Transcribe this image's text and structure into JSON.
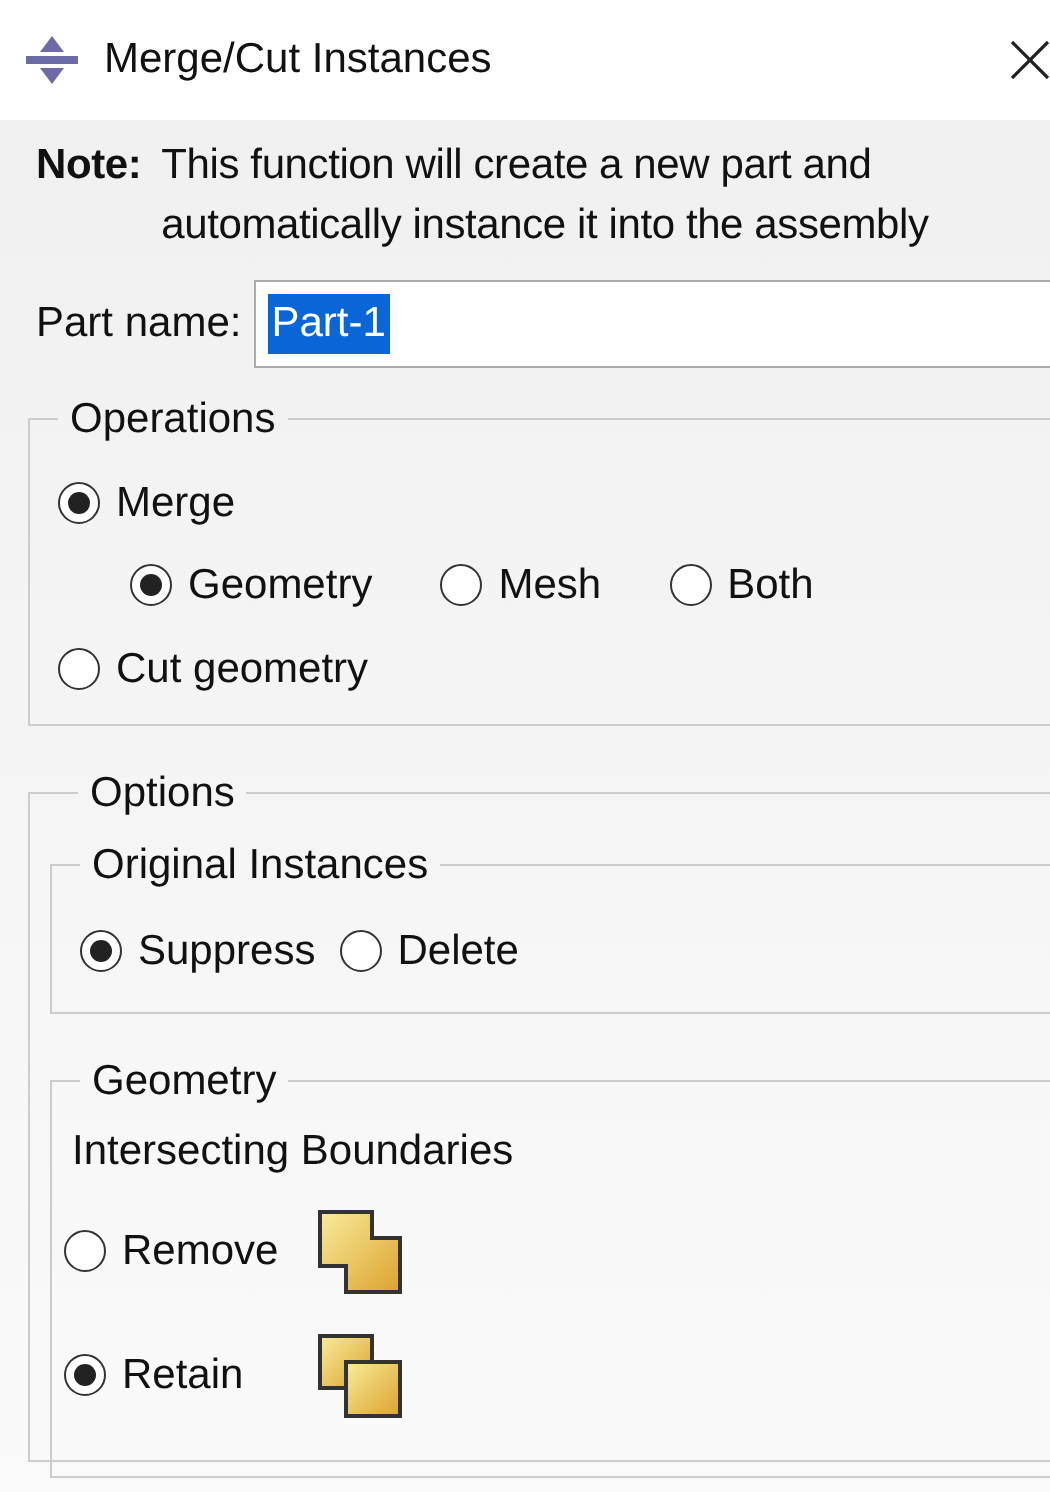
{
  "window": {
    "title": "Merge/Cut Instances"
  },
  "note": {
    "label": "Note:",
    "lines": [
      "This function will create a new part and",
      "automatically instance it into the assembly"
    ]
  },
  "part_name": {
    "label": "Part name:",
    "value": "Part-1"
  },
  "operations": {
    "title": "Operations",
    "choices": [
      {
        "label": "Merge",
        "selected": true,
        "sub_choices": [
          {
            "label": "Geometry",
            "selected": true
          },
          {
            "label": "Mesh",
            "selected": false
          },
          {
            "label": "Both",
            "selected": false
          }
        ]
      },
      {
        "label": "Cut geometry",
        "selected": false
      }
    ]
  },
  "options": {
    "title": "Options",
    "original_instances": {
      "title": "Original Instances",
      "choices": [
        {
          "label": "Suppress",
          "selected": true
        },
        {
          "label": "Delete",
          "selected": false
        }
      ]
    },
    "geometry": {
      "title": "Geometry",
      "label": "Intersecting Boundaries",
      "choices": [
        {
          "label": "Remove",
          "selected": false,
          "kind": "remove"
        },
        {
          "label": "Retain",
          "selected": true,
          "kind": "retain"
        }
      ]
    }
  }
}
